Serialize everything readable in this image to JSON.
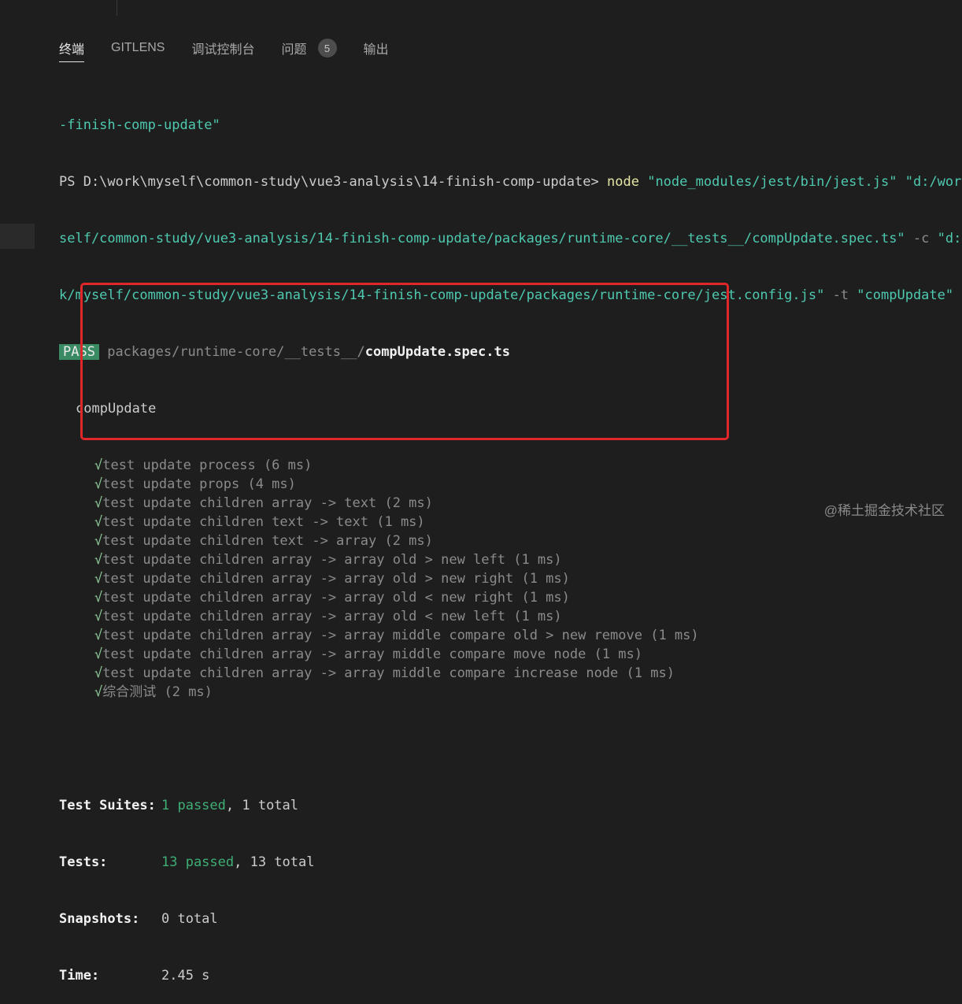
{
  "tabs": [
    {
      "label": "终端",
      "active": true
    },
    {
      "label": "GITLENS"
    },
    {
      "label": "调试控制台"
    },
    {
      "label": "问题",
      "badge": "5"
    },
    {
      "label": "输出"
    }
  ],
  "terminal": {
    "line0": "-finish-comp-update\"",
    "prompt": "PS D:\\work\\myself\\common-study\\vue3-analysis\\14-finish-comp-update>",
    "cmd_node": "node",
    "cmd_arg1": "\"node_modules/jest/bin/jest.js\"",
    "cmd_arg2_start": "\"d:/work/m",
    "line2_a": "self/common-study/vue3-analysis/14-finish-comp-update/packages/runtime-core/__tests__/compUpdate.spec.ts\"",
    "line2_flag": "-c",
    "line2_b": "\"d:/wo",
    "line3_a": "k/myself/common-study/vue3-analysis/14-finish-comp-update/packages/runtime-core/jest.config.js\"",
    "line3_flag": "-t",
    "line3_b": "\"compUpdate\"",
    "pass_badge": "PASS",
    "test_path_dir": "packages/runtime-core/__tests__/",
    "test_path_file": "compUpdate.spec.ts",
    "suite_name": "compUpdate",
    "check_mark": "√",
    "tests": [
      "test update process (6 ms)",
      "test update props (4 ms)",
      "test update children array -> text (2 ms)",
      "test update children text -> text (1 ms)",
      "test update children text -> array (2 ms)",
      "test update children array -> array old > new left (1 ms)",
      "test update children array -> array old > new right (1 ms)",
      "test update children array -> array old < new right (1 ms)",
      "test update children array -> array old < new left (1 ms)",
      "test update children array -> array middle compare old > new remove (1 ms)",
      "test update children array -> array middle compare move node (1 ms)",
      "test update children array -> array middle compare increase node (1 ms)",
      "综合测试 (2 ms)"
    ],
    "summary": {
      "suites_label": "Test Suites:",
      "suites_passed": "1 passed",
      "suites_rest": ", 1 total",
      "tests_label": "Tests:",
      "tests_passed": "13 passed",
      "tests_rest": ", 13 total",
      "snapshots_label": "Snapshots:",
      "snapshots_value": "0 total",
      "time_label": "Time:",
      "time_value": "2.45 s"
    }
  },
  "watermark": "@稀土掘金技术社区",
  "colors": {
    "background": "#1e1e1e",
    "pass_badge": "#3a8a64",
    "string": "#4ec9b0",
    "command": "#e5e5a4",
    "highlight_box": "#e0282a"
  }
}
